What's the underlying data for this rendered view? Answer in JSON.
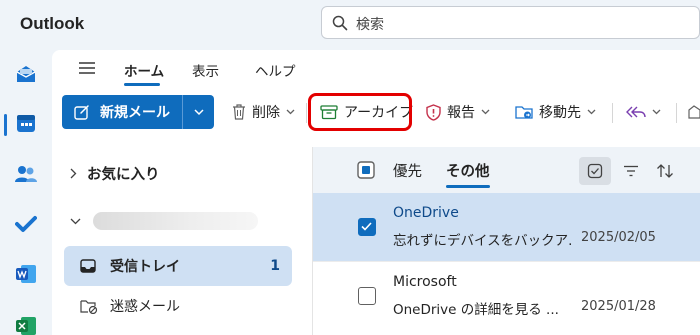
{
  "app": {
    "title": "Outlook"
  },
  "search": {
    "placeholder": "検索"
  },
  "tabs": [
    "ホーム",
    "表示",
    "ヘルプ"
  ],
  "ribbon": {
    "new_mail": "新規メール",
    "delete": "削除",
    "archive": "アーカイブ",
    "report": "報告",
    "move_to": "移動先"
  },
  "folders": {
    "favorites": "お気に入り",
    "items": [
      {
        "name": "受信トレイ",
        "count": "1"
      },
      {
        "name": "迷惑メール",
        "count": ""
      }
    ]
  },
  "mail_list": {
    "focused_tab": "優先",
    "other_tab": "その他",
    "messages": [
      {
        "sender": "OneDrive",
        "subject": "忘れずにデバイスをバックア...",
        "date": "2025/02/05",
        "selected": true
      },
      {
        "sender": "Microsoft",
        "subject": "OneDrive の詳細を見る ...",
        "date": "2025/01/28",
        "selected": false
      }
    ]
  },
  "colors": {
    "accent": "#0f6cbd",
    "highlight_box": "#e30000",
    "selected_bg": "#cfe0f3"
  }
}
